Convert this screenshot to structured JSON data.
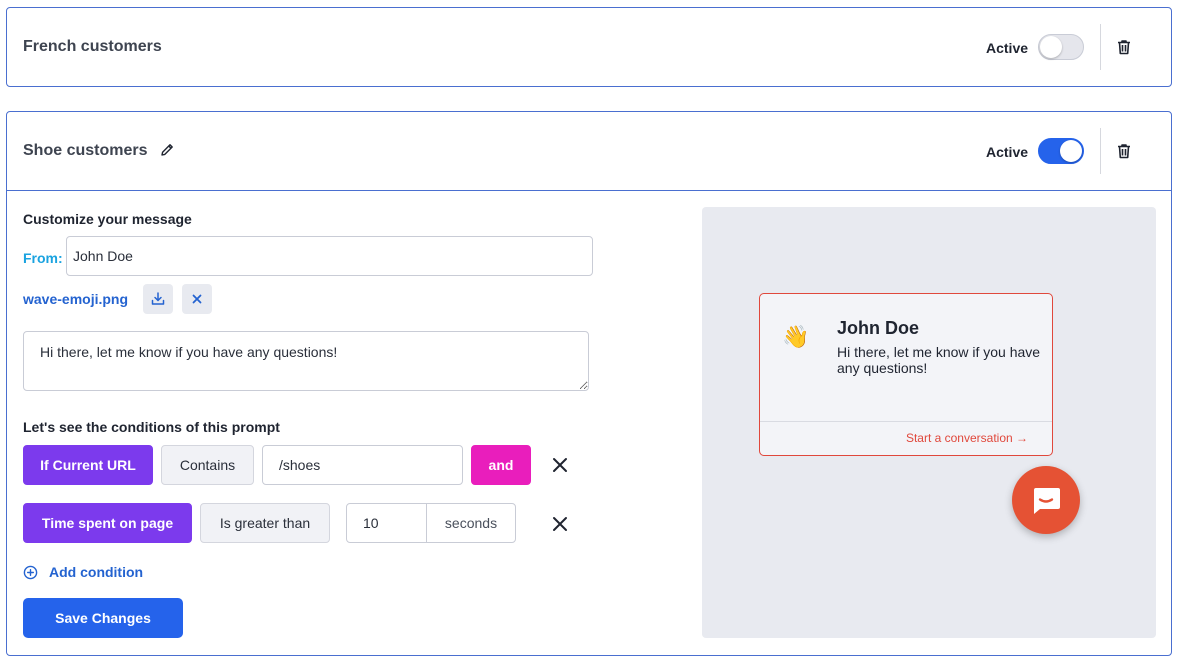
{
  "segments": [
    {
      "title": "French customers",
      "active_label": "Active",
      "active": false
    },
    {
      "title": "Shoe customers",
      "active_label": "Active",
      "active": true
    }
  ],
  "editor": {
    "customize_heading": "Customize your message",
    "from_label": "From:",
    "from_value": "John Doe",
    "attachment_name": "wave-emoji.png",
    "message_value": "Hi there, let me know if you have any questions!",
    "conditions_heading": "Let's see the conditions of this prompt",
    "conditions": [
      {
        "field": "If Current URL",
        "operator": "Contains",
        "value": "/shoes",
        "joiner": "and"
      },
      {
        "field": "Time spent on page",
        "operator": "Is greater than",
        "value": "10",
        "unit": "seconds"
      }
    ],
    "add_condition_label": "Add condition",
    "save_label": "Save Changes"
  },
  "preview": {
    "emoji": "👋",
    "name": "John Doe",
    "message": "Hi there, let me know if you have any questions!",
    "cta": "Start a conversation →"
  },
  "colors": {
    "accent": "#2563eb",
    "purple": "#7c3aed",
    "pink": "#e91ebc",
    "brand_red": "#e55234",
    "from_label": "#1aa3e0"
  }
}
